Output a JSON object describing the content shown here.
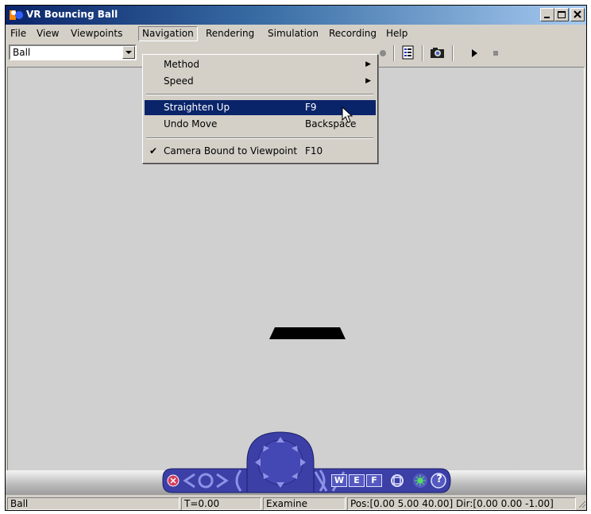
{
  "window": {
    "title": "VR Bouncing Ball"
  },
  "menubar": {
    "items": [
      {
        "label": "File"
      },
      {
        "label": "View"
      },
      {
        "label": "Viewpoints"
      },
      {
        "label": "Navigation"
      },
      {
        "label": "Rendering"
      },
      {
        "label": "Simulation"
      },
      {
        "label": "Recording"
      },
      {
        "label": "Help"
      }
    ]
  },
  "toolbar": {
    "viewpoint_value": "Ball"
  },
  "navigation_menu": {
    "items": [
      {
        "label": "Method",
        "submenu": true
      },
      {
        "label": "Speed",
        "submenu": true
      },
      {
        "label": "Straighten Up",
        "accel": "F9",
        "highlighted": true
      },
      {
        "label": "Undo Move",
        "accel": "Backspace"
      },
      {
        "label": "Camera Bound to Viewpoint",
        "accel": "F10",
        "checked": true
      }
    ]
  },
  "navpanel": {
    "w_label": "W",
    "e_label": "E",
    "f_label": "F",
    "help_label": "?"
  },
  "statusbar": {
    "viewpoint": "Ball",
    "time": "T=0.00",
    "mode": "Examine",
    "position": "Pos:[0.00 5.00 40.00] Dir:[0.00 0.00 -1.00]"
  },
  "colors": {
    "titlebar": "#0a246a",
    "highlight": "#0a246a",
    "nav_panel": "#3b3fa6"
  },
  "icons": [
    "record-icon",
    "properties-icon",
    "capture-frame-icon",
    "play-icon",
    "stop-icon",
    "close-icon",
    "help-icon"
  ]
}
